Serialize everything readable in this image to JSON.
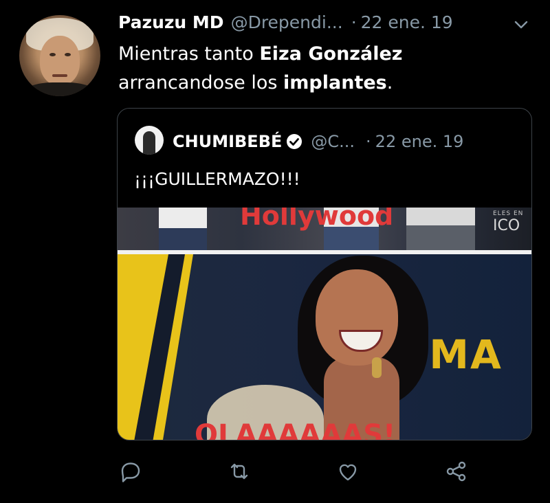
{
  "tweet": {
    "display_name": "Pazuzu MD",
    "handle": "@Drependi...",
    "separator": "·",
    "timestamp": "22 ene. 19",
    "text_parts": [
      "Mientras tanto ",
      "Eiza González",
      " arrancandose los ",
      "implantes",
      "."
    ]
  },
  "quoted": {
    "display_name": "CHUMIBEBÉ",
    "verified": true,
    "handle": "@C...",
    "separator": "·",
    "timestamp": "22 ene. 19",
    "text": "¡¡¡GUILLERMAZO!!!",
    "media": {
      "top_caption": "Hollywood",
      "top_badge_small": "ELES EN",
      "top_badge": "ICO",
      "bottom_sign": "OMA",
      "bottom_caption": "OLAAAAAAS!"
    }
  },
  "actions": {
    "icons": [
      "reply-icon",
      "retweet-icon",
      "like-icon",
      "share-icon"
    ]
  },
  "colors": {
    "background": "#000000",
    "text": "#ffffff",
    "muted": "#8899a6",
    "border": "#3d4349",
    "caption_red": "#e03a3a",
    "sign_yellow": "#e3b81d"
  }
}
